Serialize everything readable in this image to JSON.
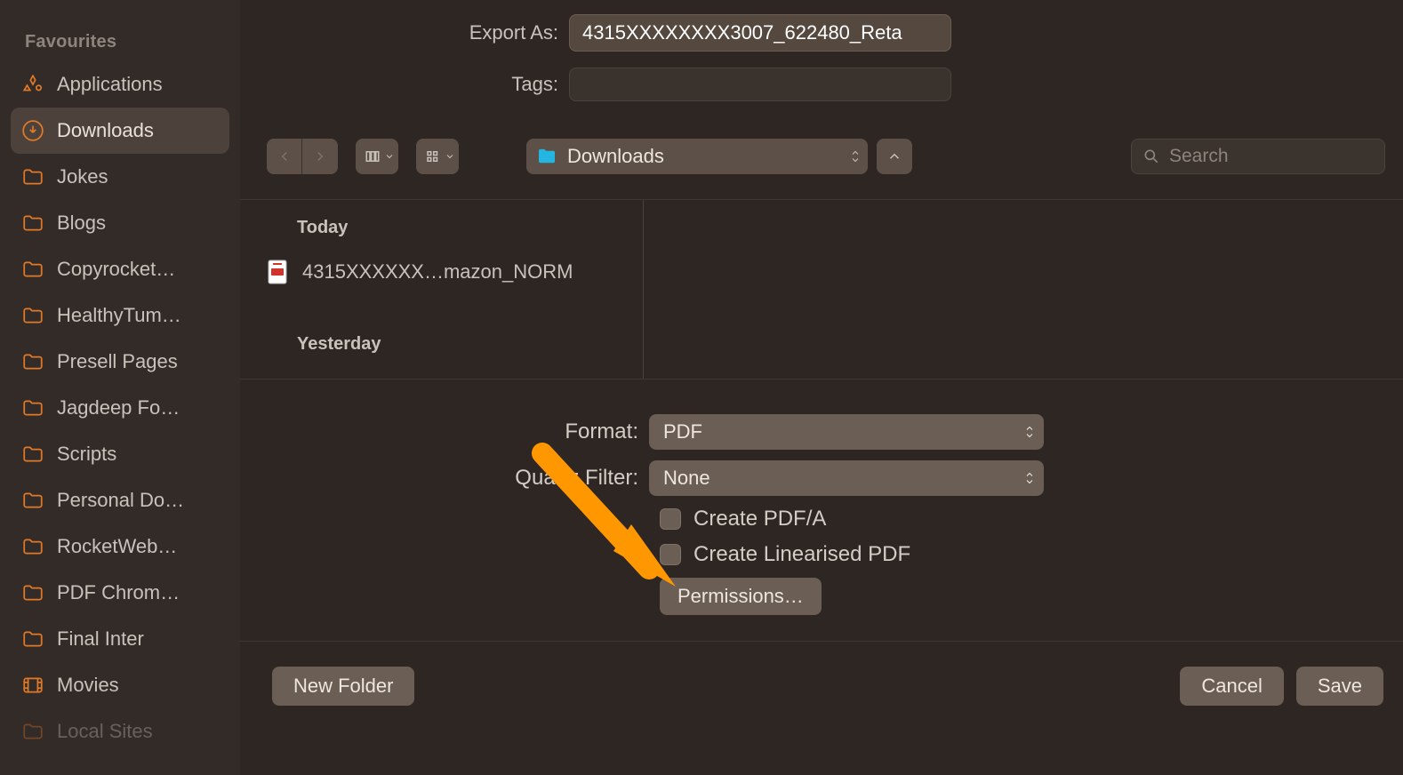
{
  "sidebar": {
    "heading": "Favourites",
    "items": [
      {
        "label": "Applications",
        "icon": "apps"
      },
      {
        "label": "Downloads",
        "icon": "downloads"
      },
      {
        "label": "Jokes",
        "icon": "folder"
      },
      {
        "label": "Blogs",
        "icon": "folder"
      },
      {
        "label": "Copyrocket…",
        "icon": "folder"
      },
      {
        "label": "HealthyTum…",
        "icon": "folder"
      },
      {
        "label": "Presell Pages",
        "icon": "folder"
      },
      {
        "label": "Jagdeep Fo…",
        "icon": "folder"
      },
      {
        "label": "Scripts",
        "icon": "folder"
      },
      {
        "label": "Personal Do…",
        "icon": "folder"
      },
      {
        "label": "RocketWeb…",
        "icon": "folder"
      },
      {
        "label": "PDF Chrom…",
        "icon": "folder"
      },
      {
        "label": "Final Inter",
        "icon": "folder"
      },
      {
        "label": "Movies",
        "icon": "movies"
      },
      {
        "label": "Local Sites",
        "icon": "folder"
      }
    ],
    "selected_index": 1
  },
  "top_form": {
    "export_as_label": "Export As:",
    "export_as_value": "4315XXXXXXXX3007_622480_Reta",
    "tags_label": "Tags:"
  },
  "toolbar": {
    "location_label": "Downloads",
    "search_placeholder": "Search"
  },
  "browser": {
    "sections": [
      {
        "title": "Today",
        "files": [
          {
            "name": "4315XXXXXX…mazon_NORM",
            "kind": "pdf"
          }
        ]
      },
      {
        "title": "Yesterday",
        "files": []
      }
    ]
  },
  "options": {
    "format_label": "Format:",
    "format_value": "PDF",
    "quartz_label": "Quartz Filter:",
    "quartz_value": "None",
    "check_pdfa": "Create PDF/A",
    "check_linear": "Create Linearised PDF",
    "permissions_btn": "Permissions…"
  },
  "bottom": {
    "new_folder": "New Folder",
    "cancel": "Cancel",
    "save": "Save"
  },
  "colors": {
    "accent": "#e07a28",
    "annotation": "#ff9800"
  }
}
